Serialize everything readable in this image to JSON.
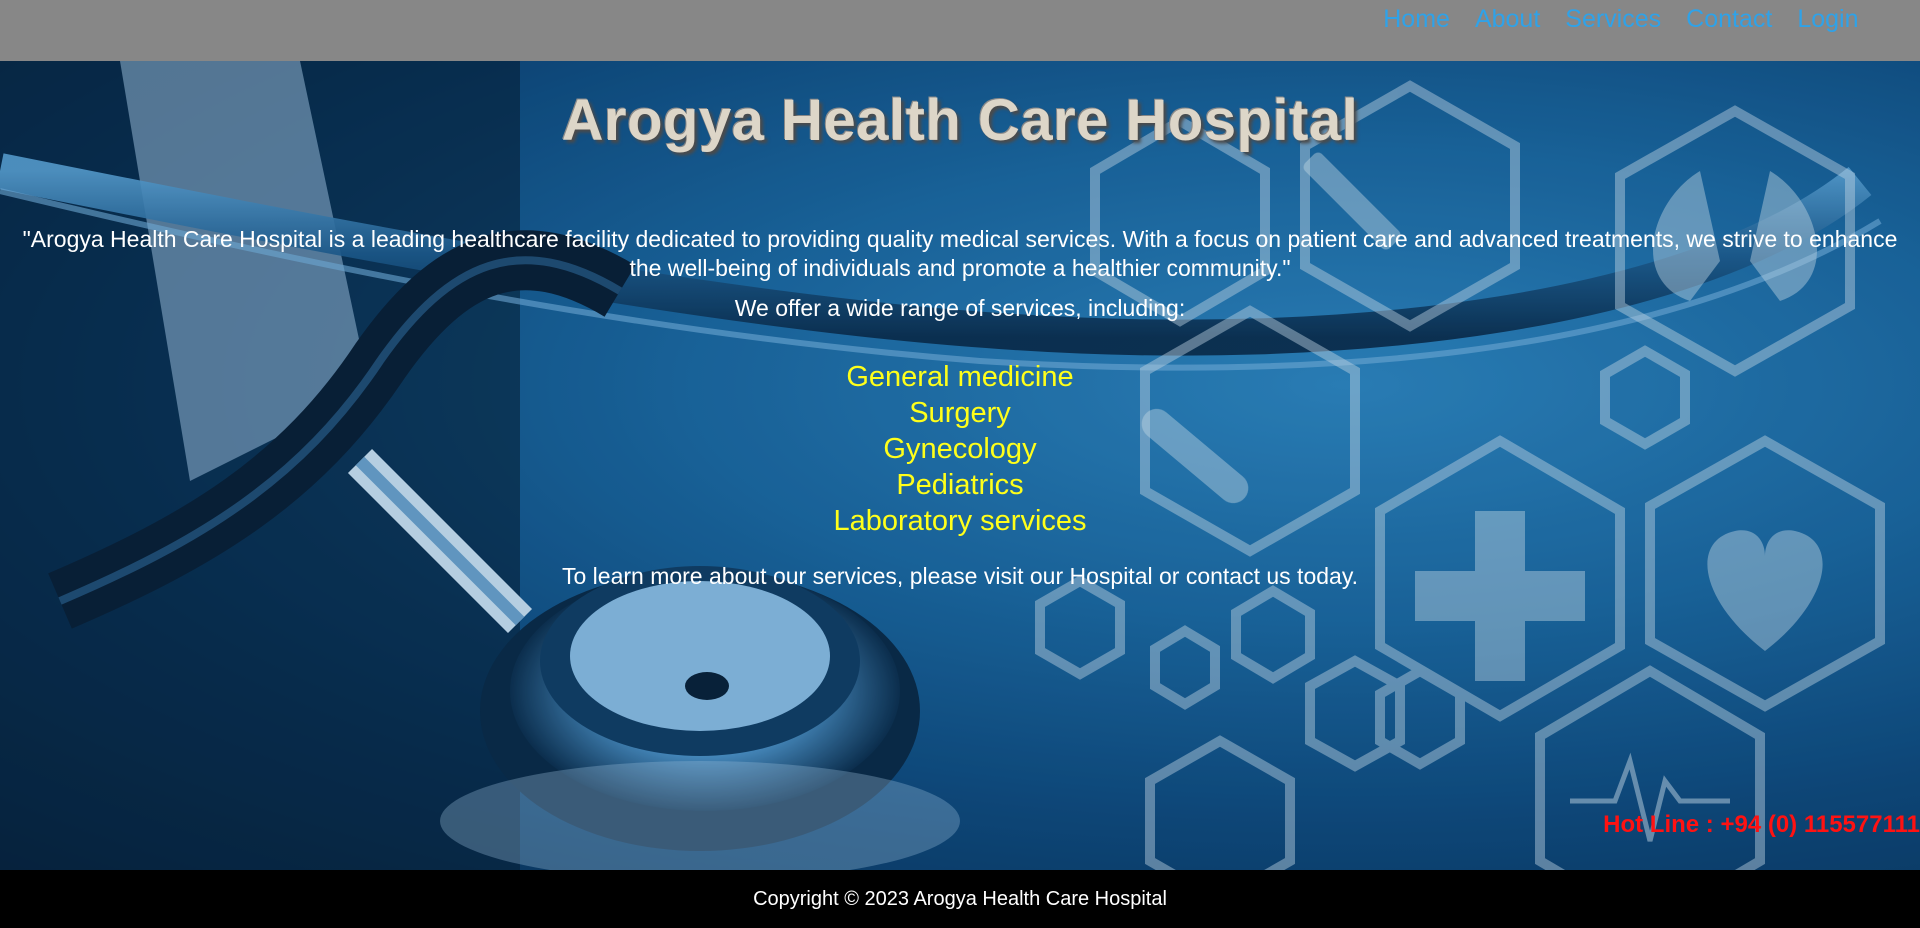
{
  "nav": {
    "items": [
      {
        "label": "Home"
      },
      {
        "label": "About"
      },
      {
        "label": "Services"
      },
      {
        "label": "Contact"
      },
      {
        "label": "Login"
      }
    ]
  },
  "hero": {
    "title": "Arogya Health Care Hospital",
    "quote": "\"Arogya Health Care Hospital is a leading healthcare facility dedicated to providing quality medical services. With a focus on patient care and advanced treatments, we strive to enhance the well-being of individuals and promote a healthier community.\"",
    "intro": "We offer a wide range of services, including:",
    "services": [
      "General medicine",
      "Surgery",
      "Gynecology",
      "Pediatrics",
      "Laboratory services"
    ],
    "cta": "To learn more about our services, please visit our Hospital or contact us today.",
    "hotline": "Hot Line : +94 (0) 115577111"
  },
  "footer": {
    "copyright": "Copyright © 2023 Arogya Health Care Hospital"
  },
  "colors": {
    "nav_bg": "#878787",
    "nav_link": "#2fa2e8",
    "services_text": "#ffff1a",
    "hotline_text": "#ff1212",
    "footer_bg": "#000000"
  },
  "icons": [
    "stethoscope-image",
    "hexagon-icon",
    "syringe-icon",
    "lungs-icon",
    "thermometer-icon",
    "cross-icon",
    "heart-icon",
    "heartbeat-icon"
  ]
}
